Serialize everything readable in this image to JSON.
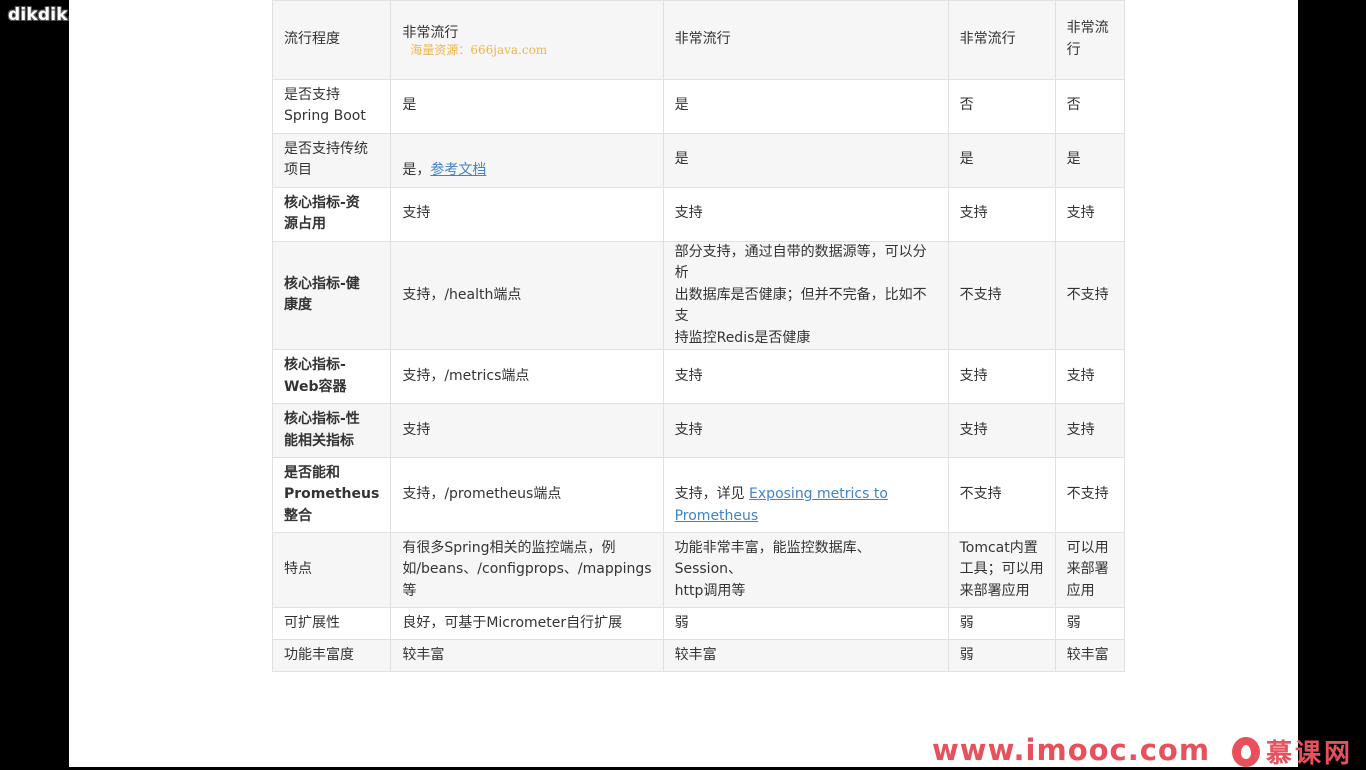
{
  "overlay": {
    "top_watermark": "dikdik.app",
    "resource_text": "海量资源：666java.com",
    "imooc_url": "www.imooc.com",
    "imooc_brand": "慕课网"
  },
  "table": {
    "rows": [
      [
        "流行程度",
        "非常流行",
        "非常流行",
        "非常流行",
        "非常流\n行"
      ],
      [
        "是否支持\nSpring Boot",
        "是",
        "是",
        "否",
        "否"
      ],
      [
        "是否支持传统\n项目",
        "是，",
        "是",
        "是",
        "是"
      ],
      [
        "核心指标-资\n源占用",
        "支持",
        "支持",
        "支持",
        "支持"
      ],
      [
        "核心指标-健\n康度",
        "支持，/health端点",
        "部分支持，通过自带的数据源等，可以分析\n出数据库是否健康；但并不完备，比如不支\n持监控Redis是否健康",
        "不支持",
        "不支持"
      ],
      [
        "核心指标-\nWeb容器",
        "支持，/metrics端点",
        "支持",
        "支持",
        "支持"
      ],
      [
        "核心指标-性\n能相关指标",
        "支持",
        "支持",
        "支持",
        "支持"
      ],
      [
        "是否能和\nPrometheus\n整合",
        "支持，/prometheus端点",
        "支持，详见 ",
        "不支持",
        "不支持"
      ],
      [
        "特点",
        "有很多Spring相关的监控端点，例\n如/beans、/configprops、/mappings\n等",
        "功能非常丰富，能监控数据库、Session、\nhttp调用等",
        "Tomcat内置\n工具；可以用\n来部署应用",
        "可以用\n来部署\n应用"
      ],
      [
        "可扩展性",
        "良好，可基于Micrometer自行扩展",
        "弱",
        "弱",
        "弱"
      ],
      [
        "功能丰富度",
        "较丰富",
        "较丰富",
        "弱",
        "较丰富"
      ]
    ],
    "links": {
      "ref_doc": "参考文档",
      "exposing_metrics": "Exposing metrics to \nPrometheus"
    }
  },
  "colors": {
    "link": "#4183c4",
    "imooc_red": "#e8505b",
    "overlay_orange": "#f0b64a"
  }
}
